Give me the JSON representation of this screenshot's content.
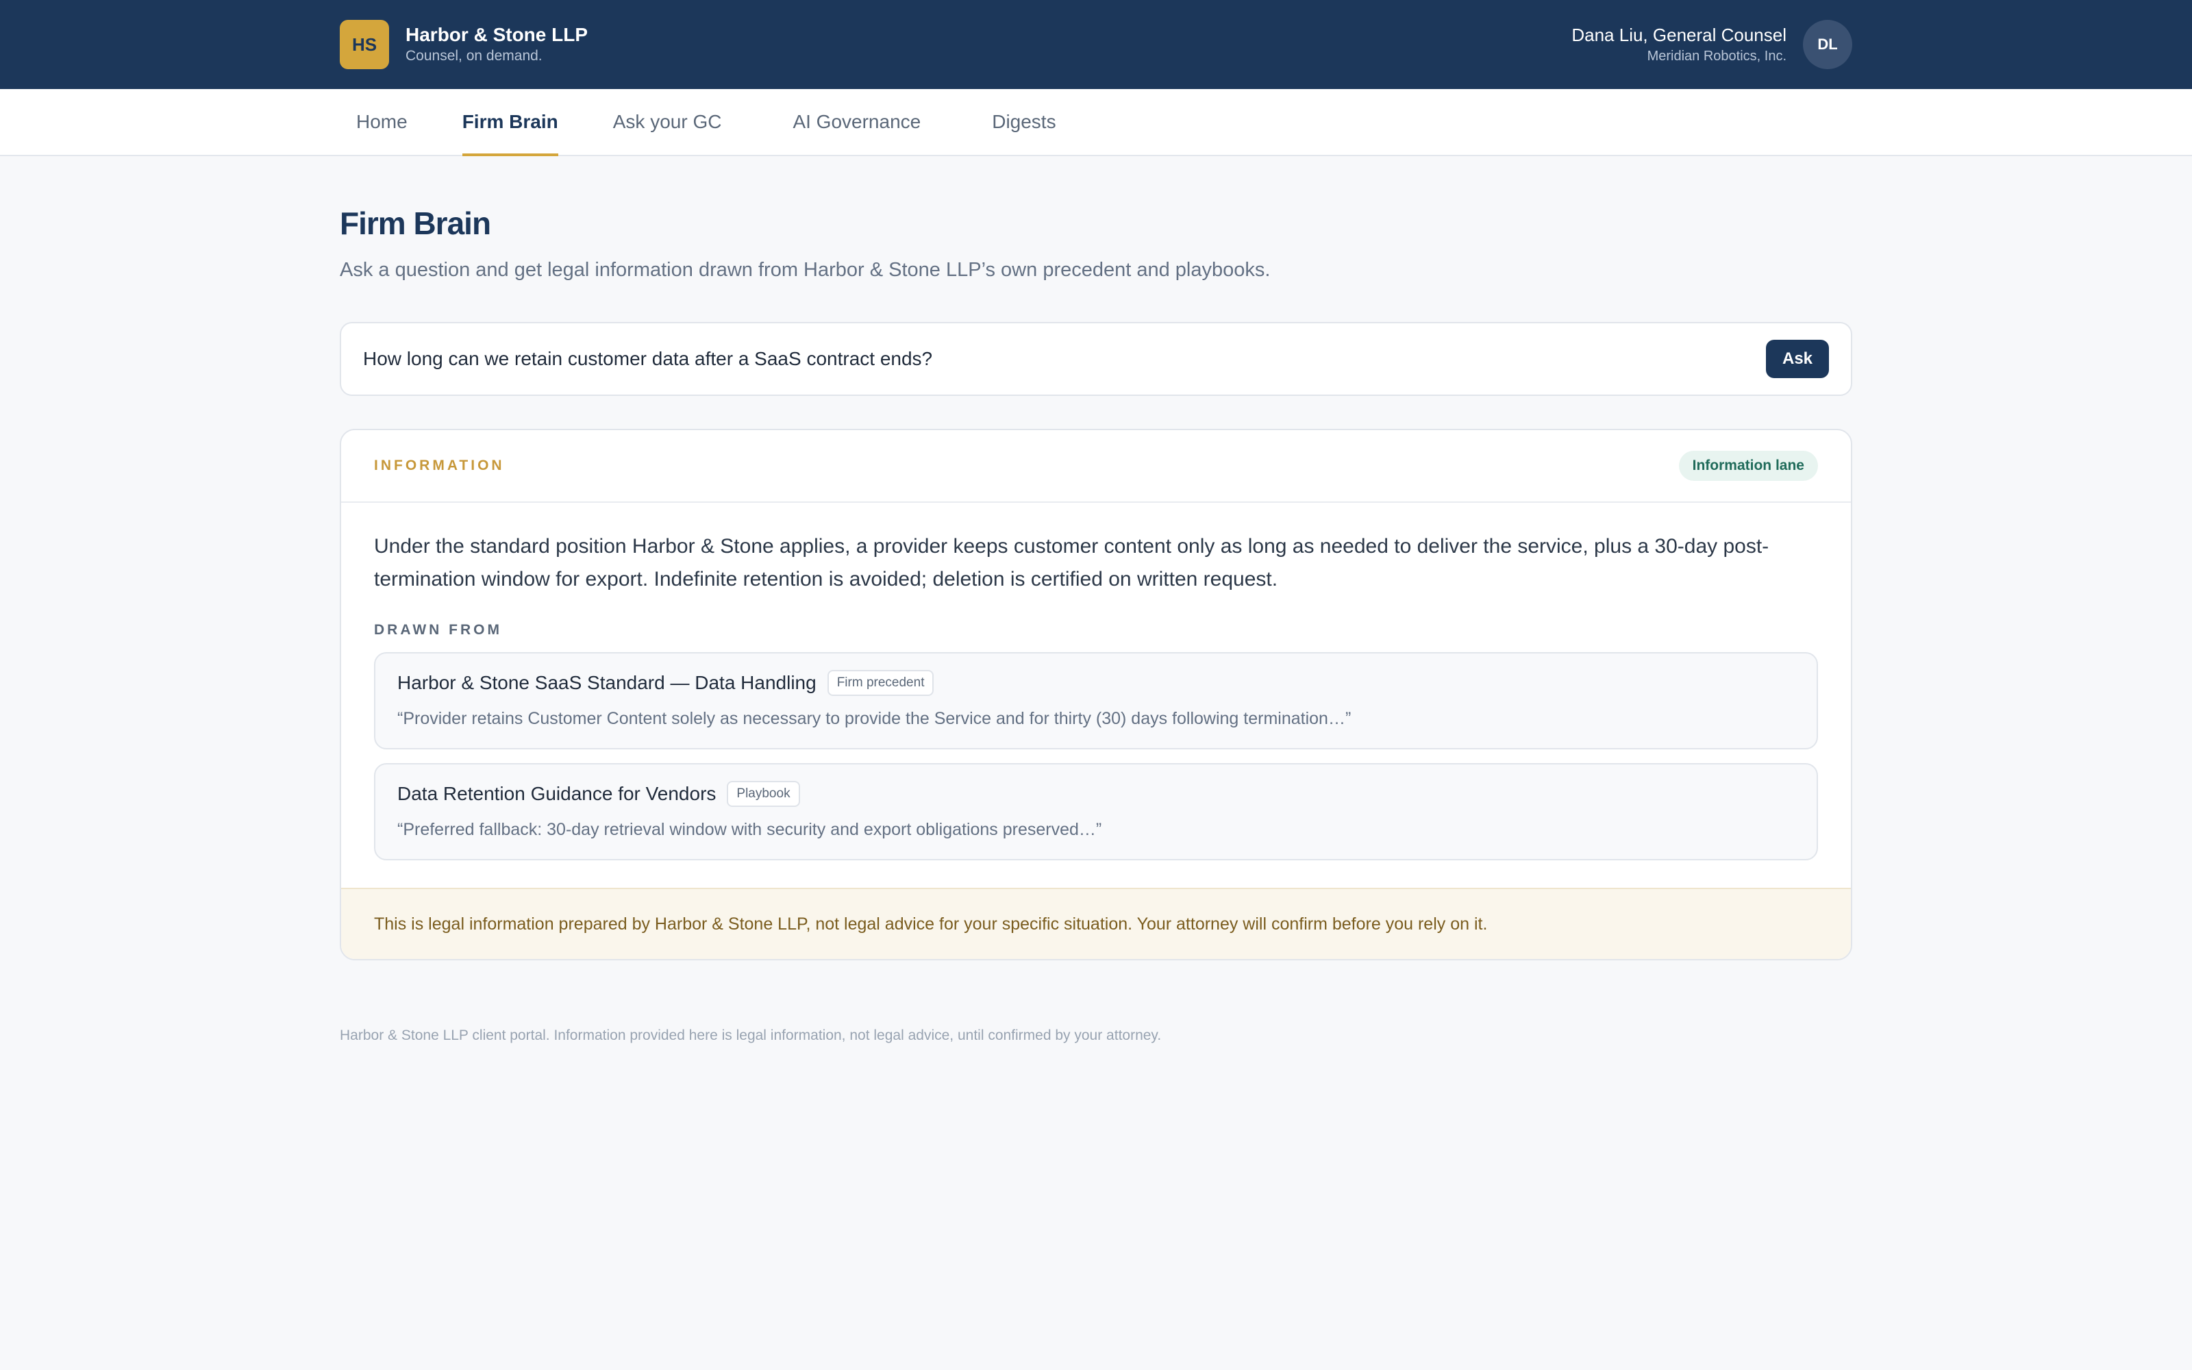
{
  "header": {
    "logo_initials": "HS",
    "firm_name": "Harbor & Stone LLP",
    "tagline": "Counsel, on demand.",
    "user_name": "Dana Liu, General Counsel",
    "user_org": "Meridian Robotics, Inc.",
    "avatar_initials": "DL"
  },
  "nav": {
    "items": [
      {
        "label": "Home"
      },
      {
        "label": "Firm Brain"
      },
      {
        "label": "Ask your GC"
      },
      {
        "label": "AI Governance"
      },
      {
        "label": "Digests"
      }
    ],
    "active": "Firm Brain"
  },
  "main": {
    "title": "Firm Brain",
    "subtitle": "Ask a question and get legal information drawn from Harbor & Stone LLP’s own precedent and playbooks.",
    "ask": {
      "value": "How long can we retain customer data after a SaaS contract ends?",
      "button_label": "Ask"
    },
    "result": {
      "section_label": "INFORMATION",
      "lane_badge": "Information lane",
      "answer": "Under the standard position Harbor & Stone applies, a provider keeps customer content only as long as needed to deliver the service, plus a 30-day post-termination window for export. Indefinite retention is avoided; deletion is certified on written request.",
      "drawn_from_label": "DRAWN FROM",
      "sources": [
        {
          "title": "Harbor & Stone SaaS Standard — Data Handling",
          "tag": "Firm precedent",
          "quote": "“Provider retains Customer Content solely as necessary to provide the Service and for thirty (30) days following termination…”"
        },
        {
          "title": "Data Retention Guidance for Vendors",
          "tag": "Playbook",
          "quote": "“Preferred fallback: 30-day retrieval window with security and export obligations preserved…”"
        }
      ],
      "disclaimer": "This is legal information prepared by Harbor & Stone LLP, not legal advice for your specific situation. Your attorney will confirm before you rely on it."
    }
  },
  "footer": {
    "text": "Harbor & Stone LLP client portal. Information provided here is legal information, not legal advice, until confirmed by your attorney."
  },
  "colors": {
    "navy": "#1c375a",
    "gold": "#d4a63c",
    "teal_badge": "#1f6b5a"
  }
}
